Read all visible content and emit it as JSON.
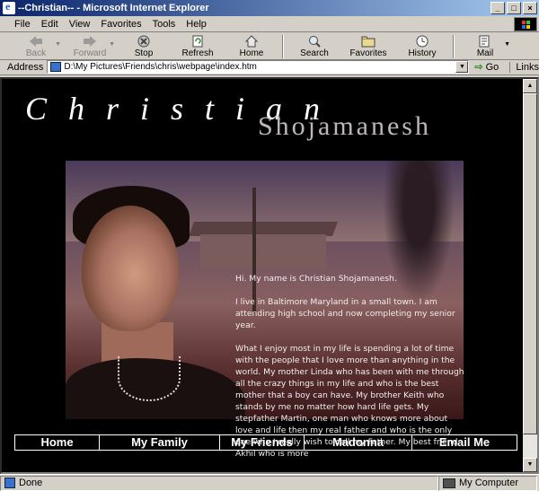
{
  "window": {
    "title": "--Christian-- - Microsoft Internet Explorer"
  },
  "menu": [
    "File",
    "Edit",
    "View",
    "Favorites",
    "Tools",
    "Help"
  ],
  "toolbar": {
    "back": "Back",
    "forward": "Forward",
    "stop": "Stop",
    "refresh": "Refresh",
    "home": "Home",
    "search": "Search",
    "favorites": "Favorites",
    "history": "History",
    "mail": "Mail"
  },
  "address": {
    "label": "Address",
    "value": "D:\\My Pictures\\Friends\\chris\\webpage\\index.htm",
    "go": "Go",
    "links": "Links"
  },
  "page": {
    "first_name": "Christian",
    "last_name": "Shojamanesh",
    "bio": [
      "Hi. My name is Christian Shojamanesh.",
      "I live in Baltimore Maryland in a small town. I am attending high school and now completing my senior year.",
      "What I enjoy most in my life is spending a lot of time with the people that I love more than anything in the world. My mother Linda who has been with me through all the crazy things in my life and who is the best mother that a boy can have. My brother Keith who stands by me no matter how hard life gets. My stepfather Martin, one man who knows more about love and life then my real father and who is the only one who I really wish to call my Father. My best friend Akhil who is more"
    ],
    "nav": [
      "Home",
      "My Family",
      "My Friends",
      "Madonna",
      "Email Me"
    ]
  },
  "status": {
    "left": "Done",
    "right": "My Computer"
  },
  "colors": {
    "titlebar_start": "#0a246a",
    "titlebar_end": "#a6caf0",
    "page_bg": "#000000",
    "text": "#ffffff",
    "surname": "#bfb7b7"
  }
}
